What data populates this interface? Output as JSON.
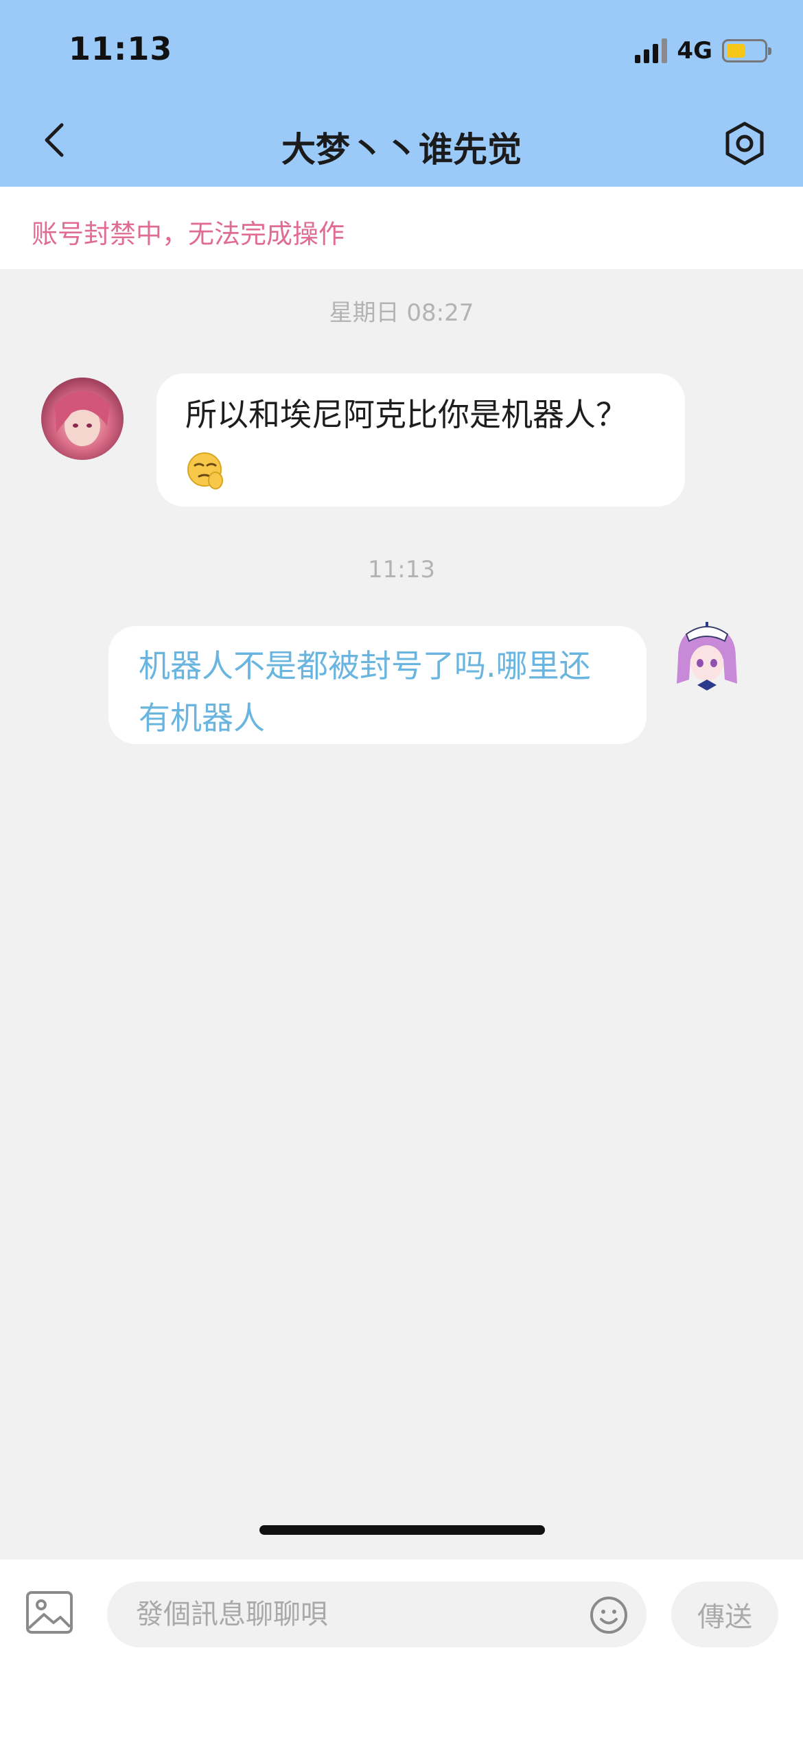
{
  "status_bar": {
    "time": "11:13",
    "network": "4G",
    "battery_level": 0.5
  },
  "nav": {
    "title": "大梦丶丶谁先觉",
    "back_icon": "chevron-left-icon",
    "settings_icon": "hexagon-gear-icon"
  },
  "banner": {
    "text": "账号封禁中，无法完成操作"
  },
  "messages": [
    {
      "timestamp": "星期日 08:27",
      "direction": "incoming",
      "text": "所以和埃尼阿克比你是机器人？",
      "emoji": "smirk-hand-emoji"
    },
    {
      "timestamp": "11:13",
      "direction": "outgoing",
      "text_line1": "机器人不是都被封号了吗.哪里还",
      "text_line2": "有机器人"
    }
  ],
  "input_bar": {
    "placeholder": "發個訊息聊聊唄",
    "send_label": "傳送",
    "image_icon": "image-icon",
    "emoji_icon": "smiley-icon"
  },
  "colors": {
    "header_bg": "#9bc9f8",
    "banner_text": "#e06b93",
    "outgoing_text": "#6ab5e0",
    "page_bg": "#f1f1f2"
  }
}
